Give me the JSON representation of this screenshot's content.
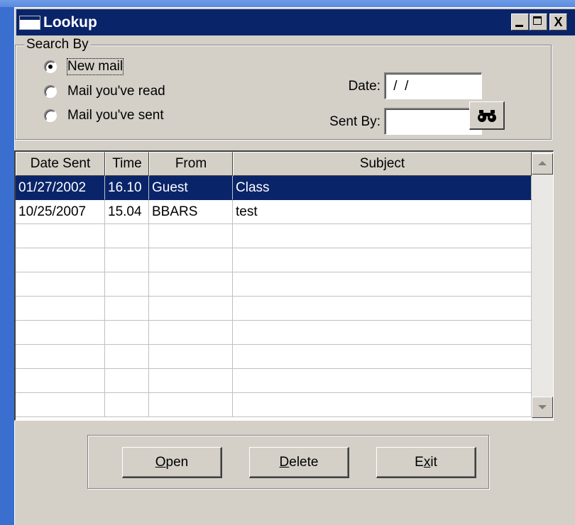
{
  "window": {
    "title": "Lookup",
    "close_glyph": "X"
  },
  "search": {
    "legend": "Search By",
    "radios": [
      {
        "label": "New mail",
        "checked": true
      },
      {
        "label": "Mail you've read",
        "checked": false
      },
      {
        "label": "Mail you've sent",
        "checked": false
      }
    ],
    "date_label": "Date:",
    "date_value": " /  /",
    "sent_by_label": "Sent By:",
    "sent_by_value": ""
  },
  "grid": {
    "columns": [
      "Date Sent",
      "Time",
      "From",
      "Subject"
    ],
    "rows": [
      {
        "date": "01/27/2002",
        "time": "16.10",
        "from": "Guest",
        "subject": "Class",
        "selected": true
      },
      {
        "date": "10/25/2007",
        "time": "15.04",
        "from": "BBARS",
        "subject": "test",
        "selected": false
      }
    ],
    "empty_rows": 8
  },
  "buttons": {
    "open": {
      "access": "O",
      "rest": "pen"
    },
    "delete": {
      "access": "D",
      "rest": "elete"
    },
    "exit": {
      "pre": "E",
      "access": "x",
      "rest": "it"
    }
  },
  "colors": {
    "titlebar": "#0a246a",
    "face": "#d4d0c8",
    "selection": "#0a246a",
    "desktop": "#3a6ecf"
  },
  "icons": [
    "window-icon",
    "minimize-icon",
    "maximize-icon",
    "close-icon",
    "binoculars-icon",
    "scroll-up-icon",
    "scroll-down-icon"
  ]
}
